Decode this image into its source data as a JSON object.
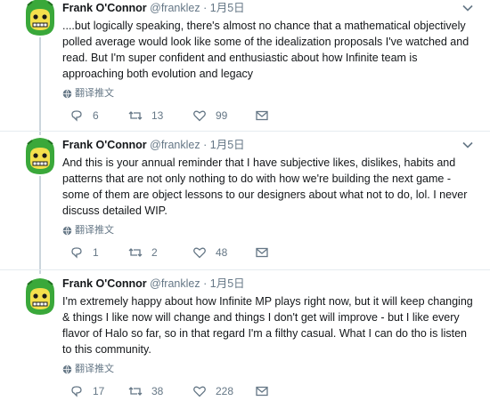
{
  "tweets": [
    {
      "name": "Frank O'Connor",
      "handle": "@franklez",
      "separator": "·",
      "date": "1月5日",
      "text": "....but logically speaking, there's almost no chance that a mathematical objectively polled average would look like some of the idealization proposals I've watched and read. But I'm super confident and enthusiastic about how Infinite team is approaching both evolution and legacy",
      "translate_label": "翻译推文",
      "replies": "6",
      "retweets": "13",
      "likes": "99"
    },
    {
      "name": "Frank O'Connor",
      "handle": "@franklez",
      "separator": "·",
      "date": "1月5日",
      "text": "And this is your annual reminder that I have subjective likes, dislikes, habits and patterns that are not only nothing to do with how we're building the next game - some of them are object lessons to our designers about what not to do, lol. I never discuss detailed WIP.",
      "translate_label": "翻译推文",
      "replies": "1",
      "retweets": "2",
      "likes": "48"
    },
    {
      "name": "Frank O'Connor",
      "handle": "@franklez",
      "separator": "·",
      "date": "1月5日",
      "text": "I'm extremely happy about how Infinite MP plays right now, but it will keep changing & things I like now will change and things I don't get will improve - but I like every flavor of Halo so far, so in that regard I'm a filthy casual. What I can do tho is listen to this community.",
      "translate_label": "翻译推文",
      "replies": "17",
      "retweets": "38",
      "likes": "228"
    }
  ],
  "icons": {
    "reply": "reply-icon",
    "retweet": "retweet-icon",
    "like": "heart-icon",
    "dm": "envelope-icon",
    "translate": "globe-icon",
    "more": "chevron-down-icon"
  },
  "colors": {
    "text": "#14171a",
    "secondary": "#657786",
    "avatar_green": "#3aa83a",
    "avatar_yellow": "#f4e04d",
    "thread_line": "#ccd6dd"
  }
}
